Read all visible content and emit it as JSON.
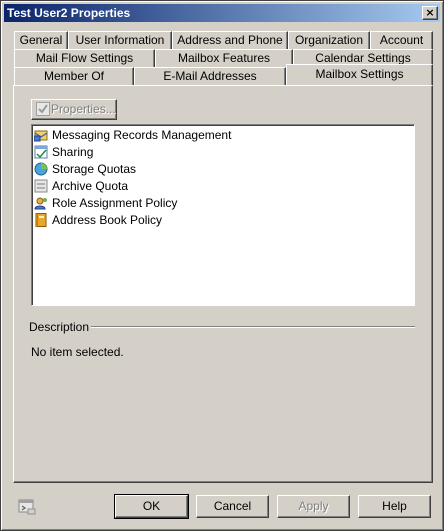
{
  "window": {
    "title": "Test User2 Properties",
    "close_label": "×"
  },
  "tabs": {
    "row1": [
      "General",
      "User Information",
      "Address and Phone",
      "Organization",
      "Account"
    ],
    "row2": [
      "Mail Flow Settings",
      "Mailbox Features",
      "Calendar Settings"
    ],
    "row3": [
      "Member Of",
      "E-Mail Addresses",
      "Mailbox Settings"
    ],
    "active": "Mailbox Settings"
  },
  "toolbar": {
    "properties_label": "Properties..."
  },
  "settings_list": {
    "items": [
      {
        "label": "Messaging Records Management",
        "icon": "records-management-icon"
      },
      {
        "label": "Sharing",
        "icon": "sharing-icon"
      },
      {
        "label": "Storage Quotas",
        "icon": "storage-quota-icon"
      },
      {
        "label": "Archive Quota",
        "icon": "archive-quota-icon"
      },
      {
        "label": "Role Assignment Policy",
        "icon": "role-policy-icon"
      },
      {
        "label": "Address Book Policy",
        "icon": "address-book-icon"
      }
    ]
  },
  "description": {
    "heading": "Description",
    "text": "No item selected."
  },
  "footer": {
    "ok_label": "OK",
    "cancel_label": "Cancel",
    "apply_label": "Apply",
    "help_label": "Help",
    "console_icon": "powershell-icon"
  }
}
